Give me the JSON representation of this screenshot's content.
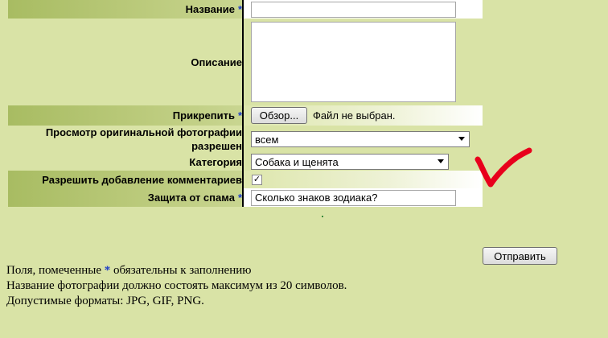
{
  "form": {
    "name": {
      "label": "Название",
      "required_mark": "*",
      "value": ""
    },
    "description": {
      "label": "Описание",
      "value": ""
    },
    "attach": {
      "label": "Прикрепить",
      "required_mark": "*",
      "browse_label": "Обзор...",
      "file_status": "Файл не выбран."
    },
    "view_original": {
      "label_line1": "Просмотр оригинальной фотографии",
      "label_line2": "разрешен",
      "selected": "всем"
    },
    "category": {
      "label": "Категория",
      "selected": "Собака и щенята"
    },
    "allow_comments": {
      "label": "Разрешить добавление комментариев",
      "checked": true,
      "check_glyph": "✓"
    },
    "antispam": {
      "label": "Защита от спама",
      "required_mark": "*",
      "value": "Сколько знаков зодиака?"
    },
    "submit_label": "Отправить"
  },
  "notes": {
    "line1_before": "Поля, помеченные",
    "required_mark": "*",
    "line1_after": "обязательны к заполнению",
    "line2": "Название фотографии должно состоять максимум из 20 символов.",
    "line3": "Допустимые форматы: JPG, GIF, PNG."
  },
  "annotation": {
    "color": "#e8001c",
    "icon": "handdrawn-checkmark-icon"
  },
  "colors": {
    "background": "#d9e3a6",
    "required": "#1c3cc8"
  }
}
